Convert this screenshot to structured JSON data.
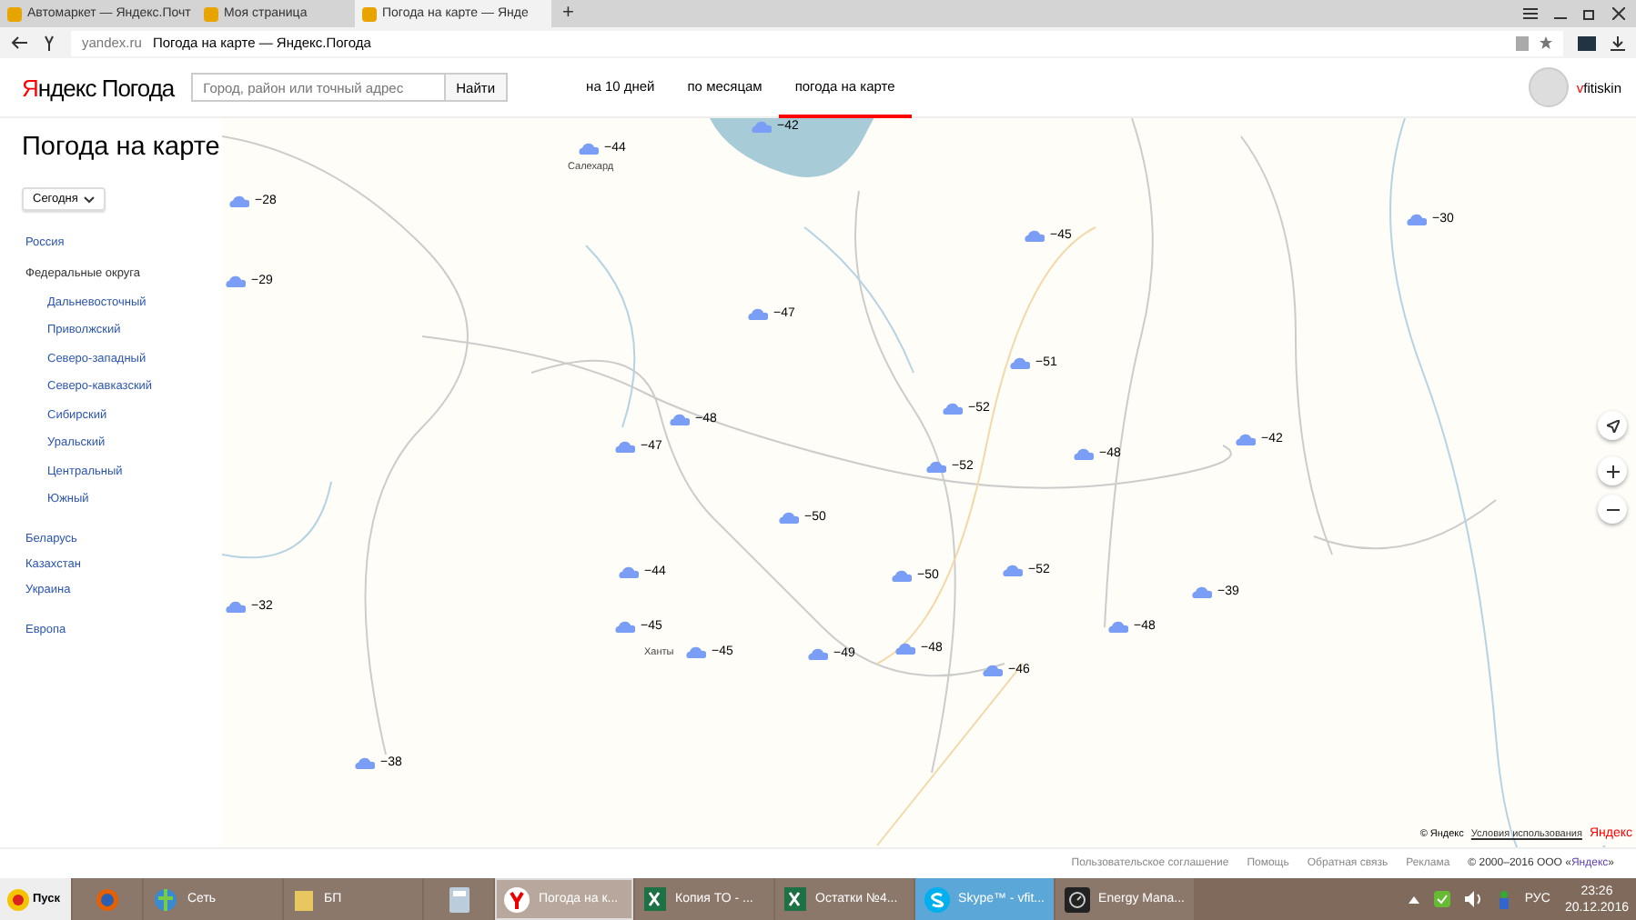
{
  "browser": {
    "tabs": [
      {
        "title": "Автомаркет — Яндекс.Почт",
        "selected": false
      },
      {
        "title": "Моя страница",
        "selected": false
      },
      {
        "title": "Погода на карте — Янде",
        "selected": true
      }
    ],
    "new_tab": "+",
    "address": {
      "domain": "yandex.ru",
      "title": "Погода на карте — Яндекс.Погода"
    }
  },
  "header": {
    "logo_brand": "Яндекс",
    "logo_product": "Погода",
    "search": {
      "placeholder": "Город, район или точный адрес",
      "button": "Найти"
    },
    "nav": [
      {
        "label": "на 10 дней",
        "selected": false
      },
      {
        "label": "по месяцам",
        "selected": false
      },
      {
        "label": "погода на карте",
        "selected": true
      }
    ],
    "user": "vfitiskin"
  },
  "sidebar": {
    "title": "Погода на карте",
    "period": "Сегодня",
    "links": [
      {
        "label": "Россия",
        "kind": "link"
      },
      {
        "label": "Федеральные округа",
        "kind": "heading",
        "children": [
          {
            "label": "Дальневосточный"
          },
          {
            "label": "Приволжский"
          },
          {
            "label": "Северо-западный"
          },
          {
            "label": "Северо-кавказский"
          },
          {
            "label": "Сибирский"
          },
          {
            "label": "Уральский"
          },
          {
            "label": "Центральный"
          },
          {
            "label": "Южный"
          }
        ]
      },
      {
        "label": "Беларусь",
        "kind": "group-start"
      },
      {
        "label": "Казахстан",
        "kind": "link"
      },
      {
        "label": "Украина",
        "kind": "link"
      },
      {
        "label": "Европа",
        "kind": "group-start"
      }
    ]
  },
  "map": {
    "pins": [
      {
        "temp": "−42"
      },
      {
        "temp": "−44"
      },
      {
        "temp": "−28"
      },
      {
        "temp": "−45"
      },
      {
        "temp": "−30"
      },
      {
        "temp": "−29"
      },
      {
        "temp": "−47"
      },
      {
        "temp": "−51"
      },
      {
        "temp": "−52"
      },
      {
        "temp": "−48"
      },
      {
        "temp": "−47"
      },
      {
        "temp": "−48"
      },
      {
        "temp": "−42"
      },
      {
        "temp": "−52"
      },
      {
        "temp": "−50"
      },
      {
        "temp": "−44"
      },
      {
        "temp": "−50"
      },
      {
        "temp": "−52"
      },
      {
        "temp": "−39"
      },
      {
        "temp": "−32"
      },
      {
        "temp": "−45"
      },
      {
        "temp": "−45"
      },
      {
        "temp": "−49"
      },
      {
        "temp": "−48"
      },
      {
        "temp": "−48"
      },
      {
        "temp": "−46"
      },
      {
        "temp": "−38"
      }
    ],
    "cities": [
      "Салехард",
      "Ханты"
    ],
    "copyright": "© Яндекс",
    "terms": "Условия использования",
    "map_logo": "Яндекс"
  },
  "footer": {
    "links": [
      "Пользовательское соглашение",
      "Помощь",
      "Обратная связь",
      "Реклама"
    ],
    "copyright": "© 2000–2016 ООО «",
    "company": "Яндекс",
    "copyright_end": "»"
  },
  "taskbar": {
    "start": "Пуск",
    "items": [
      {
        "selected": false
      },
      {
        "label": "Сеть",
        "selected": false
      },
      {
        "label": "БП",
        "selected": false
      },
      {
        "selected": false
      },
      {
        "label": "Погода на к...",
        "selected": true
      },
      {
        "label": "Копия ТО - ...",
        "selected": false
      },
      {
        "label": "Остатки №4...",
        "selected": false
      },
      {
        "label": "Skype™ - vfit...",
        "selected": false,
        "flashing": true
      },
      {
        "label": "Energy Mana...",
        "selected": false
      }
    ],
    "language": "РУС",
    "time": "23:26",
    "date": "20.12.2016"
  }
}
